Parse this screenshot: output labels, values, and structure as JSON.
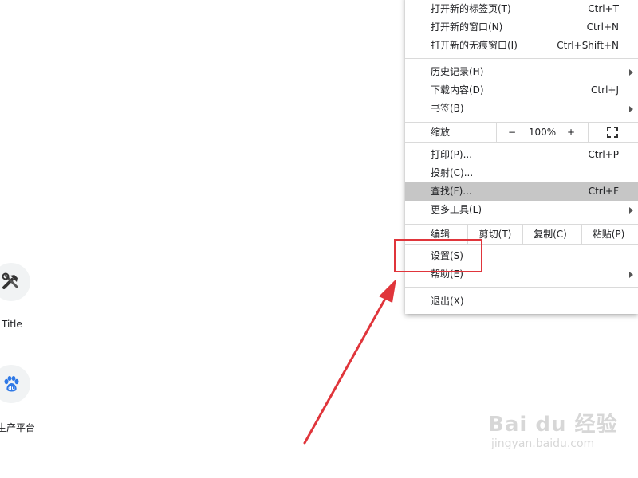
{
  "shortcuts": [
    {
      "label": "Title",
      "icon": "tools-icon"
    },
    {
      "label": "生产平台",
      "icon": "baidu-paw-icon"
    }
  ],
  "menu": {
    "new_tab": {
      "label": "打开新的标签页(T)",
      "shortcut": "Ctrl+T"
    },
    "new_window": {
      "label": "打开新的窗口(N)",
      "shortcut": "Ctrl+N"
    },
    "incognito": {
      "label": "打开新的无痕窗口(I)",
      "shortcut": "Ctrl+Shift+N"
    },
    "history": {
      "label": "历史记录(H)"
    },
    "downloads": {
      "label": "下载内容(D)",
      "shortcut": "Ctrl+J"
    },
    "bookmarks": {
      "label": "书签(B)"
    },
    "zoom": {
      "label": "缩放",
      "minus": "−",
      "value": "100%",
      "plus": "+",
      "fullscreen_icon": "fullscreen-icon"
    },
    "print": {
      "label": "打印(P)...",
      "shortcut": "Ctrl+P"
    },
    "cast": {
      "label": "投射(C)..."
    },
    "find": {
      "label": "查找(F)...",
      "shortcut": "Ctrl+F"
    },
    "more_tools": {
      "label": "更多工具(L)"
    },
    "edit": {
      "label": "编辑",
      "cut": "剪切(T)",
      "copy": "复制(C)",
      "paste": "粘贴(P)"
    },
    "settings": {
      "label": "设置(S)"
    },
    "help": {
      "label": "帮助(E)"
    },
    "exit": {
      "label": "退出(X)"
    }
  },
  "annotation": {
    "color": "#e0353b"
  },
  "watermark": {
    "main": "Bai du 经验",
    "sub": "jingyan.baidu.com"
  }
}
